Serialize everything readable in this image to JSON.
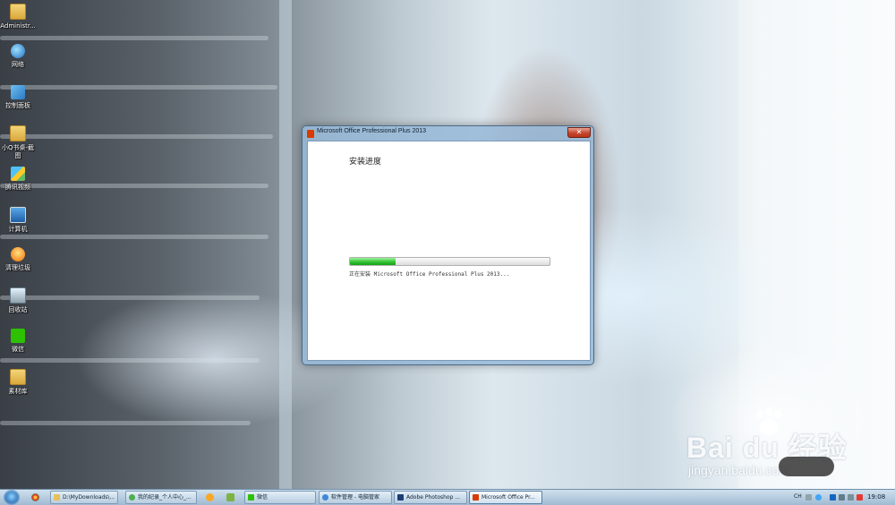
{
  "desktop": {
    "icons": [
      {
        "label": "Administr...",
        "icon": "folder-icon"
      },
      {
        "label": "网络",
        "icon": "network-icon"
      },
      {
        "label": "控制面板",
        "icon": "control-panel-icon"
      },
      {
        "label": "小Q书桌-截图",
        "icon": "folder-icon"
      },
      {
        "label": "腾讯视频",
        "icon": "tencent-video-icon"
      },
      {
        "label": "计算机",
        "icon": "computer-icon"
      },
      {
        "label": "清理垃圾",
        "icon": "cleaner-icon"
      },
      {
        "label": "回收站",
        "icon": "recycle-bin-icon"
      },
      {
        "label": "微信",
        "icon": "wechat-icon"
      },
      {
        "label": "素材库",
        "icon": "folder-icon"
      }
    ]
  },
  "dialog": {
    "title": "Microsoft Office Professional Plus 2013",
    "close_glyph": "✕",
    "heading": "安装进度",
    "progress": 0.23,
    "status": "正在安装 Microsoft Office Professional Plus 2013...",
    "colors": {
      "progress": "#2ebf2e",
      "office": "#d83b01",
      "close": "#c6462e"
    }
  },
  "watermark": {
    "logo": "Bai du 经验",
    "url": "jingyan.baidu.com"
  },
  "taskbar": {
    "quick_launch": [
      "chrome-icon",
      "norton-icon",
      "media-player-icon"
    ],
    "tasks": [
      {
        "label": "D:\\MyDownloads\\...",
        "icon": "folder-icon",
        "color": "#e8c05a"
      },
      {
        "label": "我的纪录_个人中心_...",
        "icon": "chrome-icon",
        "color": "#4caf50"
      },
      {
        "label": "微信",
        "icon": "wechat-icon",
        "color": "#2dc100"
      },
      {
        "label": "软件管理 - 电脑管家",
        "icon": "pc-manager-icon",
        "color": "#3f88d8"
      },
      {
        "label": "Adobe Photoshop ...",
        "icon": "photoshop-icon",
        "color": "#1c3d75"
      },
      {
        "label": "Microsoft Office Pr...",
        "icon": "office-icon",
        "color": "#d83b01",
        "active": true
      }
    ],
    "tray": {
      "lang": "CH",
      "icons": [
        "keyboard-icon",
        "help-icon",
        "shield-icon",
        "network-icon",
        "volume-icon",
        "flag-icon"
      ],
      "clock": "19:08"
    }
  }
}
